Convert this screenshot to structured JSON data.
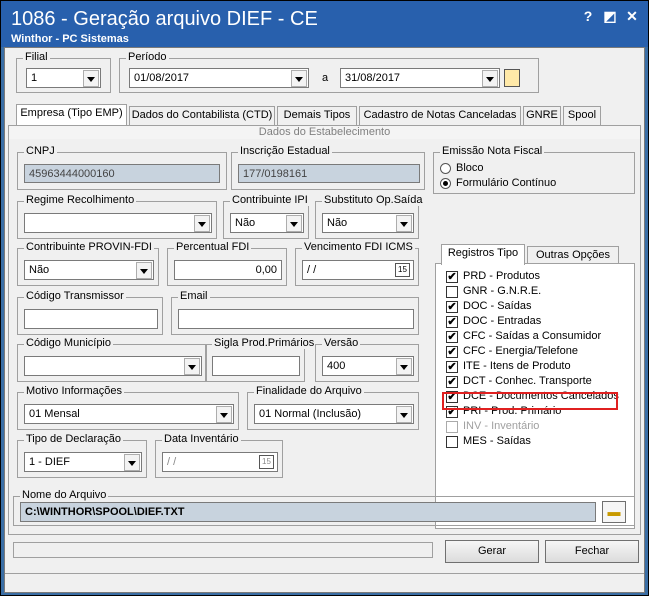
{
  "window": {
    "title": "1086 - Geração arquivo DIEF - CE",
    "subtitle": "Winthor - PC Sistemas",
    "help": "?",
    "minimize": "◩",
    "close": "✕"
  },
  "filial": {
    "label": "Filial",
    "value": "1"
  },
  "periodo": {
    "label": "Período",
    "start": "01/08/2017",
    "sep": "a",
    "end": "31/08/2017"
  },
  "tabs": [
    "Empresa (Tipo EMP)",
    "Dados do Contabilista (CTD)",
    "Demais Tipos",
    "Cadastro de Notas Canceladas",
    "GNRE",
    "Spool"
  ],
  "section_title": "Dados do Estabelecimento",
  "fields": {
    "cnpj": {
      "label": "CNPJ",
      "value": "45963444000160"
    },
    "inscricao": {
      "label": "Inscrição Estadual",
      "value": "177/0198161"
    },
    "regime": {
      "label": "Regime Recolhimento",
      "value": ""
    },
    "contrib_ipi": {
      "label": "Contribuinte IPI",
      "value": "Não"
    },
    "subst": {
      "label": "Substituto Op.Saída",
      "value": "Não"
    },
    "provin": {
      "label": "Contribuinte PROVIN-FDI",
      "value": "Não"
    },
    "perc_fdi": {
      "label": "Percentual FDI",
      "value": "0,00"
    },
    "venc_fdi": {
      "label": "Vencimento FDI ICMS",
      "value": "/ /"
    },
    "cod_trans": {
      "label": "Código Transmissor",
      "value": ""
    },
    "email": {
      "label": "Email",
      "value": ""
    },
    "cod_mun": {
      "label": "Código Município",
      "value": ""
    },
    "sigla": {
      "label": "Sigla Prod.Primários",
      "value": ""
    },
    "versao": {
      "label": "Versão",
      "value": "400"
    },
    "motivo": {
      "label": "Motivo Informações",
      "value": "01 Mensal"
    },
    "finalidade": {
      "label": "Finalidade do Arquivo",
      "value": "01 Normal (Inclusão)"
    },
    "tipo_decl": {
      "label": "Tipo de Declaração",
      "value": "1 - DIEF"
    },
    "data_inv": {
      "label": "Data Inventário",
      "value": "/ /"
    },
    "nome_arq": {
      "label": "Nome do Arquivo",
      "value": "C:\\WINTHOR\\SPOOL\\DIEF.TXT"
    }
  },
  "emissao": {
    "label": "Emissão Nota Fiscal",
    "options": [
      "Bloco",
      "Formulário Contínuo"
    ]
  },
  "reg_tabs": [
    "Registros Tipo",
    "Outras Opções"
  ],
  "registros": [
    {
      "label": "PRD - Produtos",
      "checked": true,
      "disabled": false
    },
    {
      "label": "GNR - G.N.R.E.",
      "checked": false,
      "disabled": false
    },
    {
      "label": "DOC - Saídas",
      "checked": true,
      "disabled": false
    },
    {
      "label": "DOC - Entradas",
      "checked": true,
      "disabled": false
    },
    {
      "label": "CFC - Saídas a Consumidor",
      "checked": true,
      "disabled": false
    },
    {
      "label": "CFC - Energia/Telefone",
      "checked": true,
      "disabled": false
    },
    {
      "label": "ITE - Itens de Produto",
      "checked": true,
      "disabled": false
    },
    {
      "label": "DCT - Conhec. Transporte",
      "checked": true,
      "disabled": false
    },
    {
      "label": "DCE - Documentos Cancelados",
      "checked": true,
      "disabled": false
    },
    {
      "label": "PRI - Prod. Primário",
      "checked": true,
      "disabled": false
    },
    {
      "label": "INV - Inventário",
      "checked": false,
      "disabled": true
    },
    {
      "label": "MES - Saídas",
      "checked": false,
      "disabled": false
    }
  ],
  "buttons": {
    "gerar": "Gerar",
    "fechar": "Fechar"
  },
  "colors": {
    "titlebar": "#2860ad",
    "highlight": "#e02020",
    "filename_bg": "#c8d3de"
  }
}
